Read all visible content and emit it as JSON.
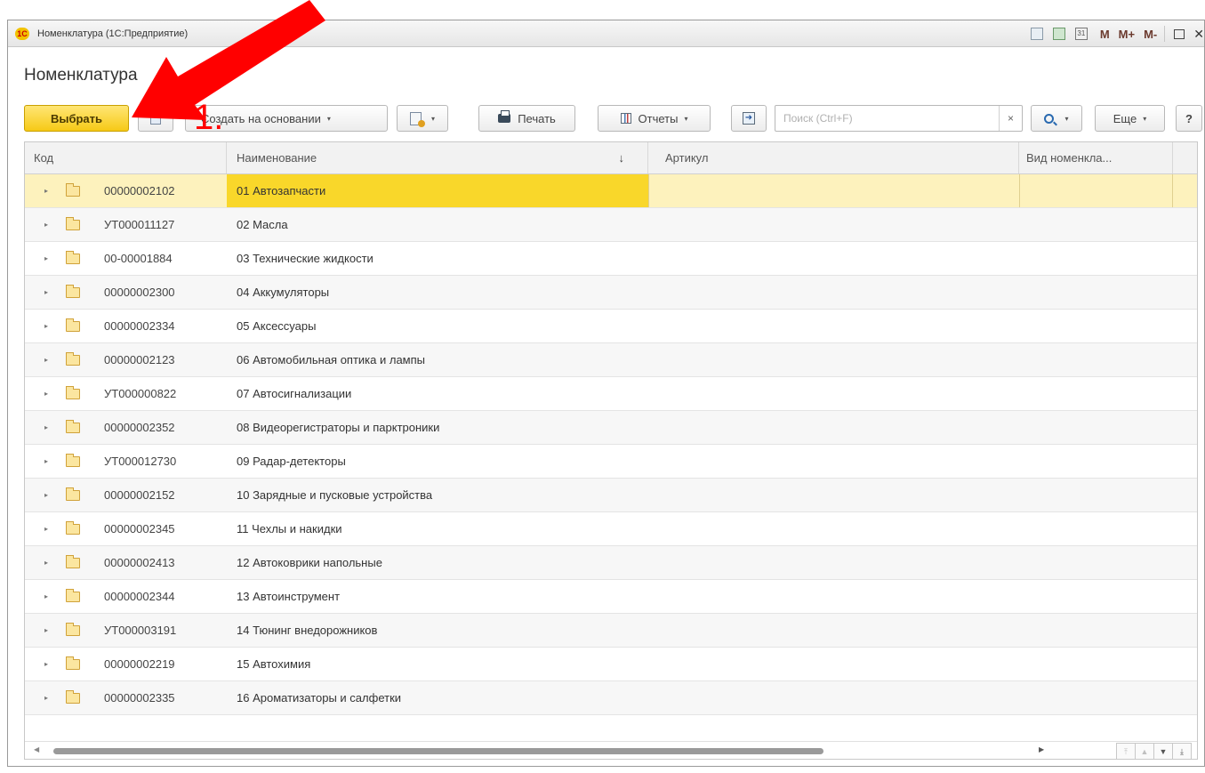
{
  "window": {
    "title": "Номенклатура  (1С:Предприятие)",
    "logo_text": "1С",
    "right_controls": [
      {
        "name": "printer-icon"
      },
      {
        "name": "calculator-icon"
      },
      {
        "name": "calendar-icon",
        "text": "31"
      }
    ],
    "memory_buttons": [
      "M",
      "M+",
      "M-"
    ],
    "close_glyph": "✕"
  },
  "form_title": "Номенклатура",
  "toolbar": {
    "select_label": "Выбрать",
    "create_based_on_label": "Создать на основании",
    "print_label": "Печать",
    "reports_label": "Отчеты",
    "search_placeholder": "Поиск (Ctrl+F)",
    "search_clear": "×",
    "more_label": "Еще",
    "help_label": "?",
    "caret": "▾"
  },
  "table": {
    "columns": [
      {
        "key": "code",
        "label": "Код"
      },
      {
        "key": "name",
        "label": "Наименование",
        "sort": "↓"
      },
      {
        "key": "article",
        "label": "Артикул"
      },
      {
        "key": "kind",
        "label": "Вид номенкла..."
      }
    ],
    "selected_index": 0,
    "rows": [
      {
        "code": "00000002102",
        "name": "01 Автозапчасти"
      },
      {
        "code": "УТ000011127",
        "name": "02 Масла"
      },
      {
        "code": "00-00001884",
        "name": "03 Технические жидкости"
      },
      {
        "code": "00000002300",
        "name": "04 Аккумуляторы"
      },
      {
        "code": "00000002334",
        "name": "05 Аксессуары"
      },
      {
        "code": "00000002123",
        "name": "06 Автомобильная оптика и лампы"
      },
      {
        "code": "УТ000000822",
        "name": "07 Автосигнализации"
      },
      {
        "code": "00000002352",
        "name": "08 Видеорегистраторы и парктроники"
      },
      {
        "code": "УТ000012730",
        "name": "09 Радар-детекторы"
      },
      {
        "code": "00000002152",
        "name": "10 Зарядные и пусковые устройства"
      },
      {
        "code": "00000002345",
        "name": "11 Чехлы и накидки"
      },
      {
        "code": "00000002413",
        "name": "12 Автоковрики напольные"
      },
      {
        "code": "00000002344",
        "name": "13 Автоинструмент"
      },
      {
        "code": "УТ000003191",
        "name": "14 Тюнинг внедорожников"
      },
      {
        "code": "00000002219",
        "name": "15 Автохимия"
      },
      {
        "code": "00000002335",
        "name": "16 Ароматизаторы и салфетки"
      }
    ]
  },
  "annotation": {
    "label": "1.",
    "color": "#ff0000"
  },
  "colors": {
    "primary_button": "#f6c916",
    "selected_row": "#fdf2bd",
    "selected_cell": "#f9d72a"
  }
}
